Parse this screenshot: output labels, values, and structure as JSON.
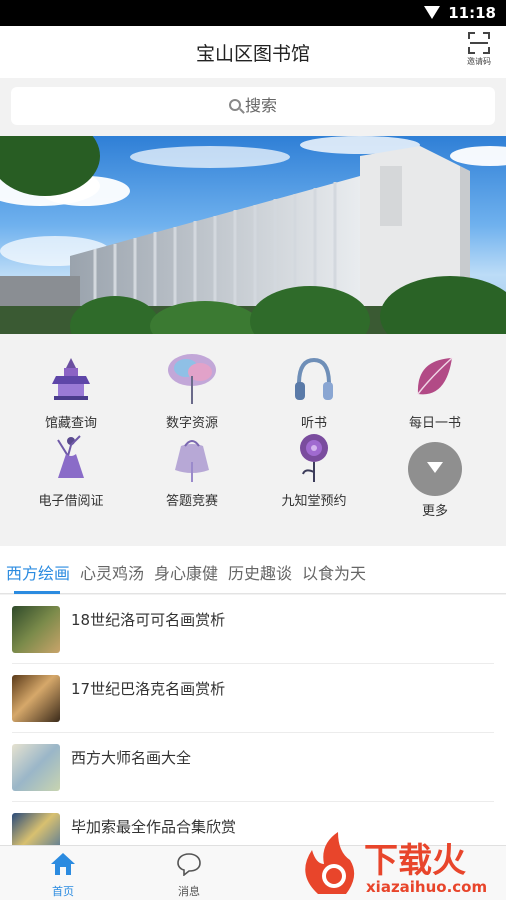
{
  "status_bar": {
    "time": "11:18"
  },
  "header": {
    "title": "宝山区图书馆",
    "scan_label": "邀请码"
  },
  "search": {
    "placeholder": "搜索"
  },
  "shortcuts": [
    {
      "label": "馆藏查询",
      "icon": "pagoda-icon"
    },
    {
      "label": "数字资源",
      "icon": "tree-icon"
    },
    {
      "label": "听书",
      "icon": "headphones-icon"
    },
    {
      "label": "每日一书",
      "icon": "leaf-icon"
    },
    {
      "label": "电子借阅证",
      "icon": "dancer-icon"
    },
    {
      "label": "答题竞赛",
      "icon": "gift-bag-icon"
    },
    {
      "label": "九知堂预约",
      "icon": "rose-icon"
    },
    {
      "label": "更多",
      "icon": "chevron-down-icon"
    }
  ],
  "category_tabs": [
    "西方绘画",
    "心灵鸡汤",
    "身心康健",
    "历史趣谈",
    "以食为天"
  ],
  "articles": [
    {
      "title": "18世纪洛可可名画赏析"
    },
    {
      "title": "17世纪巴洛克名画赏析"
    },
    {
      "title": "西方大师名画大全"
    },
    {
      "title": "毕加索最全作品合集欣赏"
    }
  ],
  "bottom_nav": [
    {
      "label": "首页",
      "icon": "home-icon"
    },
    {
      "label": "消息",
      "icon": "chat-bubble-icon"
    }
  ],
  "watermark": {
    "brand": "下载火",
    "url": "xiazaihuo.com"
  },
  "colors": {
    "accent": "#2b8be0",
    "more_button": "#8f8f8f"
  }
}
